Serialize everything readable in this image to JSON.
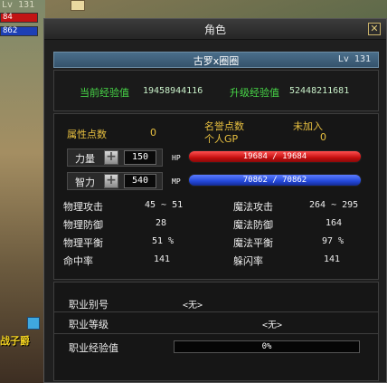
{
  "hud": {
    "level": "Lv 131",
    "hp_text": "84",
    "mp_text": "862",
    "title_badge": "战子爵"
  },
  "window": {
    "title": "角色",
    "close_label": "✕"
  },
  "character": {
    "name": "古罗x圈圈",
    "level": "Lv 131"
  },
  "experience": {
    "current_label": "当前经验值",
    "current_value": "19458944116",
    "upgrade_label": "升级经验值",
    "upgrade_value": "52448211681"
  },
  "points": {
    "attr_label": "属性点数",
    "attr_value": "0",
    "fame_label": "名誉点数",
    "fame_value": "未加入",
    "gp_label": "个人GP",
    "gp_value": "0"
  },
  "stats": {
    "strength_label": "力量",
    "strength_value": "150",
    "intellect_label": "智力",
    "intellect_value": "540",
    "plus_symbol": "+",
    "hp_tag": "HP",
    "hp_text": "19684 / 19684",
    "hp_fraction": 1.0,
    "mp_tag": "MP",
    "mp_text": "70862 / 70862",
    "mp_fraction": 1.0
  },
  "combat": {
    "rows": [
      {
        "left_label": "物理攻击",
        "left_value": "45 ~ 51",
        "right_label": "魔法攻击",
        "right_value": "264 ~ 295"
      },
      {
        "left_label": "物理防御",
        "left_value": "28",
        "right_label": "魔法防御",
        "right_value": "164"
      },
      {
        "left_label": "物理平衡",
        "left_value": "51 %",
        "right_label": "魔法平衡",
        "right_value": "97 %"
      },
      {
        "left_label": "命中率",
        "left_value": "141",
        "right_label": "躲闪率",
        "right_value": "141"
      }
    ]
  },
  "job": {
    "alias_label": "职业别号",
    "alias_value": "<无>",
    "level_label": "职业等级",
    "level_value": "<无>",
    "exp_label": "职业经验值",
    "exp_text": "0%",
    "exp_fraction": 0
  },
  "colors": {
    "green_label": "#48d848",
    "yellow_label": "#e8c040",
    "hp_bar": "#c40f0f",
    "mp_bar": "#2348d9",
    "name_bar": "#4a6e8a"
  }
}
